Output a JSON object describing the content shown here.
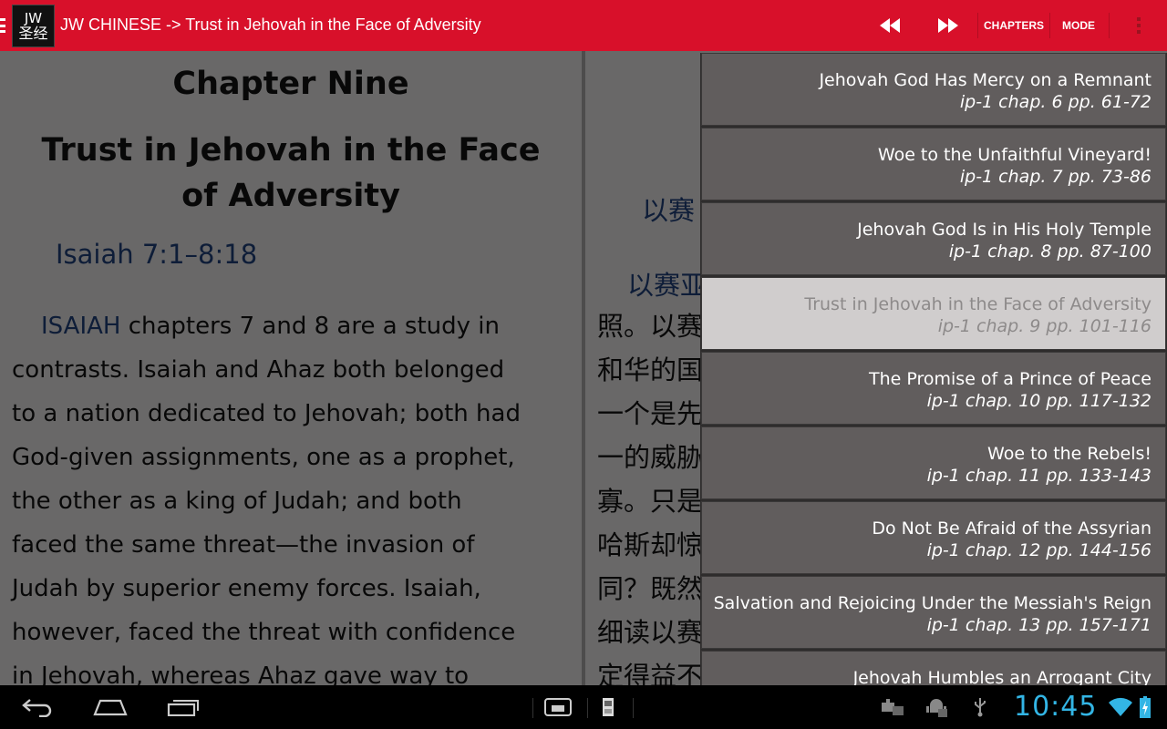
{
  "action_bar": {
    "logo_line1": "JW",
    "logo_line2": "圣经",
    "title": "JW CHINESE -> Trust in Jehovah in the Face of Adversity",
    "rewind_icon": "rewind-icon",
    "fast_forward_icon": "fast-forward-icon",
    "chapters_label": "CHAPTERS",
    "mode_label": "MODE",
    "accent_color": "#d8102a"
  },
  "english_pane": {
    "chapter_number": "Chapter Nine",
    "chapter_title": "Trust in Jehovah in the Face of Adversity",
    "scripture_ref": "Isaiah 7:1–8:18",
    "lead_word": "ISAIAH",
    "body_lines": [
      " chapters 7 and 8 are a study in",
      "contrasts. Isaiah and Ahaz both belonged",
      "to a nation dedicated to Jehovah; both had",
      "God-given assignments, one as a prophet,",
      "the other as a king of Judah; and both",
      "faced the same threat—the invasion of",
      "Judah by superior enemy forces. Isaiah,",
      "however, faced the threat with confidence",
      "in Jehovah, whereas Ahaz gave way to"
    ]
  },
  "chinese_pane": {
    "heading": "以赛",
    "scripture_ref": "以赛亚",
    "body_lines": [
      "照。以赛",
      "和华的国",
      "一个是先",
      "一的威胁",
      "寡。只是",
      "哈斯却惊",
      "同？既然",
      "细读以赛",
      "定得益不"
    ]
  },
  "chapter_list": {
    "items": [
      {
        "title": "Jehovah God Has Mercy on a Remnant",
        "ref": "ip-1 chap. 6 pp. 61-72",
        "selected": false
      },
      {
        "title": "Woe to the Unfaithful Vineyard!",
        "ref": "ip-1 chap. 7 pp. 73-86",
        "selected": false
      },
      {
        "title": "Jehovah God Is in His Holy Temple",
        "ref": "ip-1 chap. 8 pp. 87-100",
        "selected": false
      },
      {
        "title": "Trust in Jehovah in the Face of Adversity",
        "ref": "ip-1 chap. 9 pp. 101-116",
        "selected": true
      },
      {
        "title": "The Promise of a Prince of Peace",
        "ref": "ip-1 chap. 10 pp. 117-132",
        "selected": false
      },
      {
        "title": "Woe to the Rebels!",
        "ref": "ip-1 chap. 11 pp. 133-143",
        "selected": false
      },
      {
        "title": "Do Not Be Afraid of the Assyrian",
        "ref": "ip-1 chap. 12 pp. 144-156",
        "selected": false
      },
      {
        "title": "Salvation and Rejoicing Under the Messiah's Reign",
        "ref": "ip-1 chap. 13 pp. 157-171",
        "selected": false
      },
      {
        "title": "Jehovah Humbles an Arrogant City",
        "ref": "",
        "selected": false
      }
    ]
  },
  "system_bar": {
    "back_icon": "back-icon",
    "home_icon": "home-icon",
    "recents_icon": "recent-apps-icon",
    "screenshot_icon": "screenshot-icon",
    "sd-card-icon": "sd-card-icon",
    "clock": "10:45",
    "clock_color": "#33b5e5"
  }
}
